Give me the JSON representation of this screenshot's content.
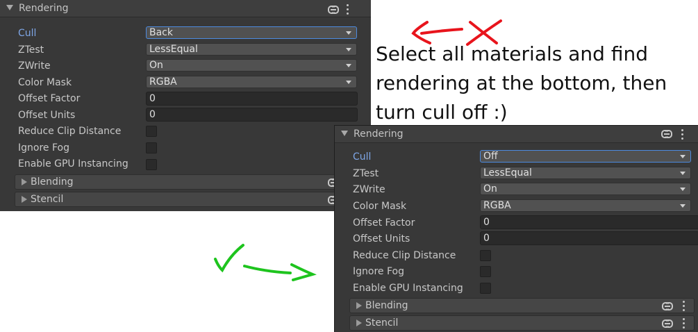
{
  "panel_before": {
    "header_title": "Rendering",
    "fields": {
      "cull": {
        "label": "Cull",
        "value": "Back"
      },
      "ztest": {
        "label": "ZTest",
        "value": "LessEqual"
      },
      "zwrite": {
        "label": "ZWrite",
        "value": "On"
      },
      "color_mask": {
        "label": "Color Mask",
        "value": "RGBA"
      },
      "offset_factor": {
        "label": "Offset Factor",
        "value": "0"
      },
      "offset_units": {
        "label": "Offset Units",
        "value": "0"
      },
      "reduce_clip": {
        "label": "Reduce Clip Distance",
        "checked": false
      },
      "ignore_fog": {
        "label": "Ignore Fog",
        "checked": false
      },
      "gpu_instancing": {
        "label": "Enable GPU Instancing",
        "checked": false
      }
    },
    "sections": {
      "blending": "Blending",
      "stencil": "Stencil"
    }
  },
  "panel_after": {
    "header_title": "Rendering",
    "fields": {
      "cull": {
        "label": "Cull",
        "value": "Off"
      },
      "ztest": {
        "label": "ZTest",
        "value": "LessEqual"
      },
      "zwrite": {
        "label": "ZWrite",
        "value": "On"
      },
      "color_mask": {
        "label": "Color Mask",
        "value": "RGBA"
      },
      "offset_factor": {
        "label": "Offset Factor",
        "value": "0"
      },
      "offset_units": {
        "label": "Offset Units",
        "value": "0"
      },
      "reduce_clip": {
        "label": "Reduce Clip Distance",
        "checked": false
      },
      "ignore_fog": {
        "label": "Ignore Fog",
        "checked": false
      },
      "gpu_instancing": {
        "label": "Enable GPU Instancing",
        "checked": false
      }
    },
    "sections": {
      "blending": "Blending",
      "stencil": "Stencil"
    }
  },
  "annotation": {
    "note_text": "Select all materials and find rendering at the bottom, then turn cull off :)",
    "wrong_mark_color": "#e8141c",
    "right_mark_color": "#1ec41e"
  },
  "colors": {
    "panel_bg": "#383838",
    "active_label": "#7ea6e6",
    "focus_border": "#4d8be0"
  }
}
